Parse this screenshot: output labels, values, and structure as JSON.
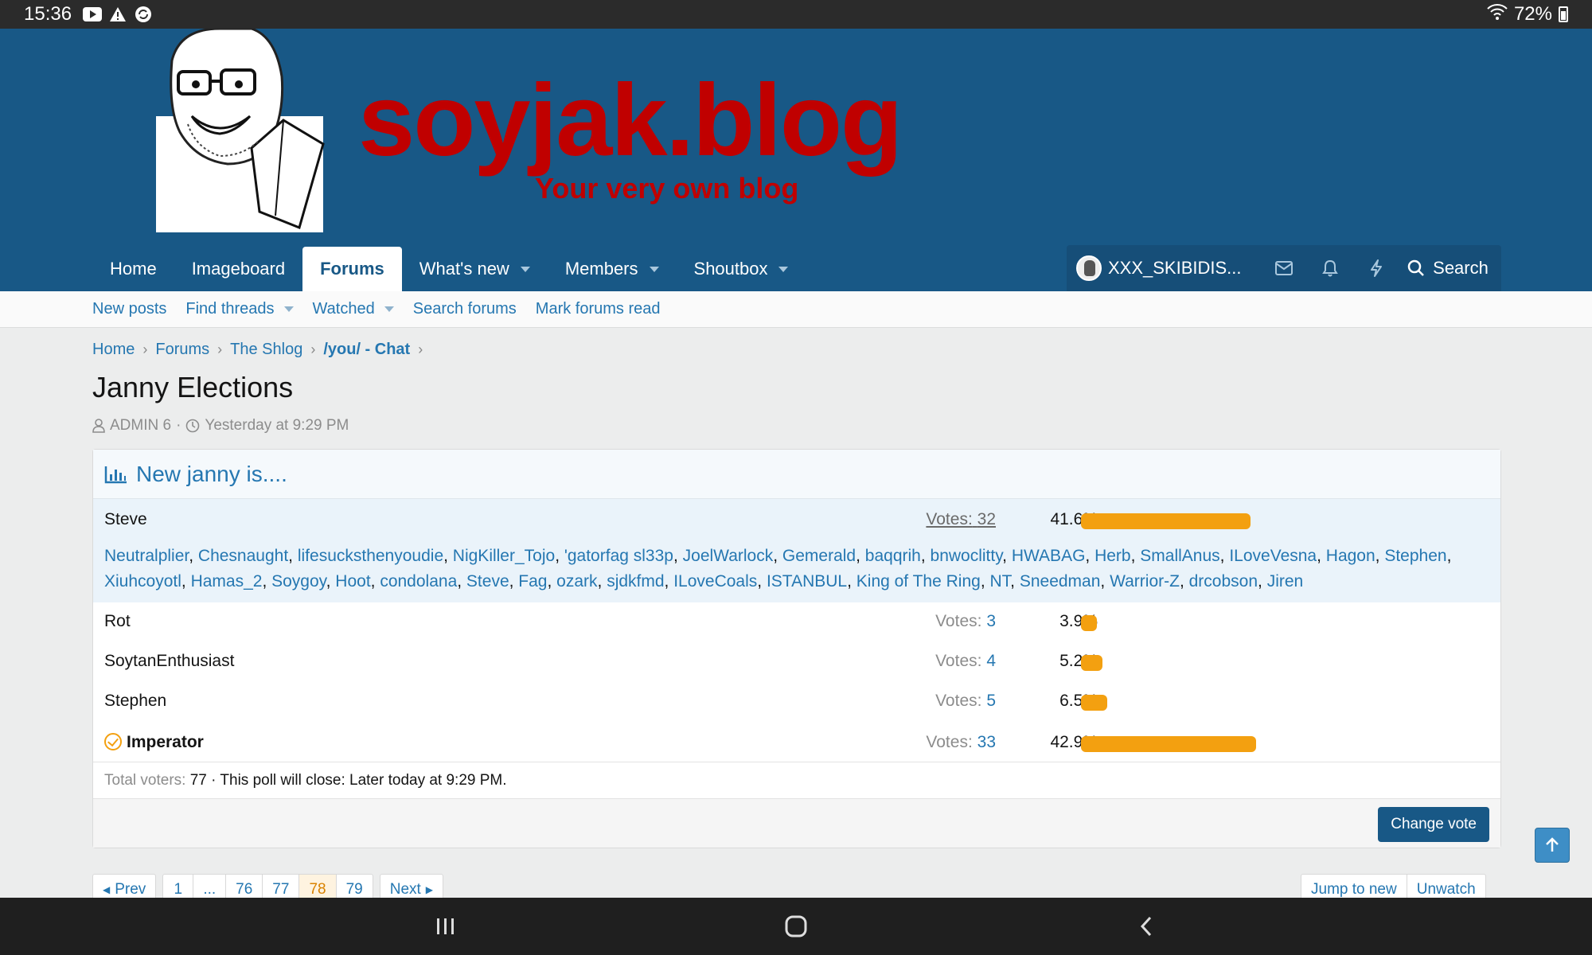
{
  "status_bar": {
    "time": "15:36",
    "battery": "72%"
  },
  "header": {
    "site_name": "soyjak.blog",
    "tagline": "Your very own blog",
    "nav_tabs": [
      {
        "label": "Home"
      },
      {
        "label": "Imageboard"
      },
      {
        "label": "Forums"
      },
      {
        "label": "What's new"
      },
      {
        "label": "Members"
      },
      {
        "label": "Shoutbox"
      }
    ],
    "username": "XXX_SKIBIDIS...",
    "search_label": "Search"
  },
  "subnav": {
    "items": [
      "New posts",
      "Find threads",
      "Watched",
      "Search forums",
      "Mark forums read"
    ]
  },
  "breadcrumb": [
    "Home",
    "Forums",
    "The Shlog",
    "/you/ - Chat"
  ],
  "thread": {
    "title": "Janny Elections",
    "author": "ADMIN 6",
    "date": "Yesterday at 9:29 PM"
  },
  "poll": {
    "question": "New janny is....",
    "votes_label": "Votes:",
    "options": [
      {
        "name": "Steve",
        "votes": "32",
        "percent": "41.6%",
        "fraction": 0.416
      },
      {
        "name": "Rot",
        "votes": "3",
        "percent": "3.9%",
        "fraction": 0.039
      },
      {
        "name": "SoytanEnthusiast",
        "votes": "4",
        "percent": "5.2%",
        "fraction": 0.052
      },
      {
        "name": "Stephen",
        "votes": "5",
        "percent": "6.5%",
        "fraction": 0.065
      },
      {
        "name": "Imperator",
        "votes": "33",
        "percent": "42.9%",
        "fraction": 0.429
      }
    ],
    "steve_voters": [
      "Neutralplier",
      "Chesnaught",
      "lifesucksthenyoudie",
      "NigKiller_Tojo",
      "'gatorfag sl33p",
      "JoelWarlock",
      "Gemerald",
      "baqqrih",
      "bnwoclitty",
      "HWABAG",
      "Herb",
      "SmallAnus",
      "ILoveVesna",
      "Hagon",
      "Stephen",
      "Xiuhcoyotl",
      "Hamas_2",
      "Soygoy",
      "Hoot",
      "condolana",
      "Steve",
      "Fag",
      "ozark",
      "sjdkfmd",
      "ILoveCoals",
      "ISTANBUL",
      "King of The Ring",
      "NT",
      "Sneedman",
      "Warrior-Z",
      "drcobson",
      "Jiren"
    ],
    "total_voters_label": "Total voters:",
    "total_voters": "77",
    "close_text": "· This poll will close: Later today at 9:29 PM.",
    "change_vote": "Change vote",
    "bar_color": "#f3a010"
  },
  "pagination": {
    "prev": "Prev",
    "pages": [
      "1",
      "...",
      "76",
      "77",
      "78",
      "79"
    ],
    "current": "78",
    "next": "Next",
    "jump_to_new": "Jump to new",
    "unwatch": "Unwatch"
  }
}
